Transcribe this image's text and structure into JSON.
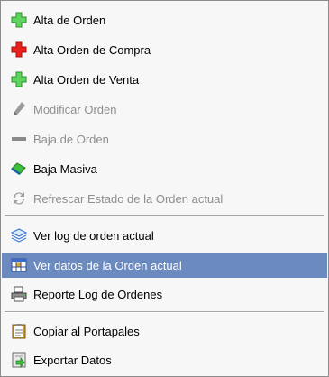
{
  "menu": {
    "items": [
      {
        "label": "Alta de Orden",
        "icon": "plus-green-icon",
        "enabled": true
      },
      {
        "label": "Alta Orden de Compra",
        "icon": "plus-red-icon",
        "enabled": true
      },
      {
        "label": "Alta Orden de Venta",
        "icon": "plus-green-icon",
        "enabled": true
      },
      {
        "label": "Modificar Orden",
        "icon": "pencil-icon",
        "enabled": false
      },
      {
        "label": "Baja de Orden",
        "icon": "minus-bar-icon",
        "enabled": false
      },
      {
        "label": "Baja Masiva",
        "icon": "eraser-icon",
        "enabled": true
      },
      {
        "label": "Refrescar Estado de la Orden actual",
        "icon": "refresh-icon",
        "enabled": false
      },
      {
        "label": "Ver log de orden actual",
        "icon": "layers-icon",
        "enabled": true
      },
      {
        "label": "Ver datos de la Orden actual",
        "icon": "table-icon",
        "enabled": true,
        "selected": true
      },
      {
        "label": "Reporte Log de Ordenes",
        "icon": "printer-icon",
        "enabled": true
      },
      {
        "label": "Copiar al Portapales",
        "icon": "clipboard-icon",
        "enabled": true
      },
      {
        "label": "Exportar Datos",
        "icon": "export-icon",
        "enabled": true
      }
    ]
  },
  "colors": {
    "selection": "#6b8ac0",
    "disabled_text": "#8e8e8e",
    "green_plus": "#3cbf3c",
    "red_plus": "#e8231c"
  }
}
